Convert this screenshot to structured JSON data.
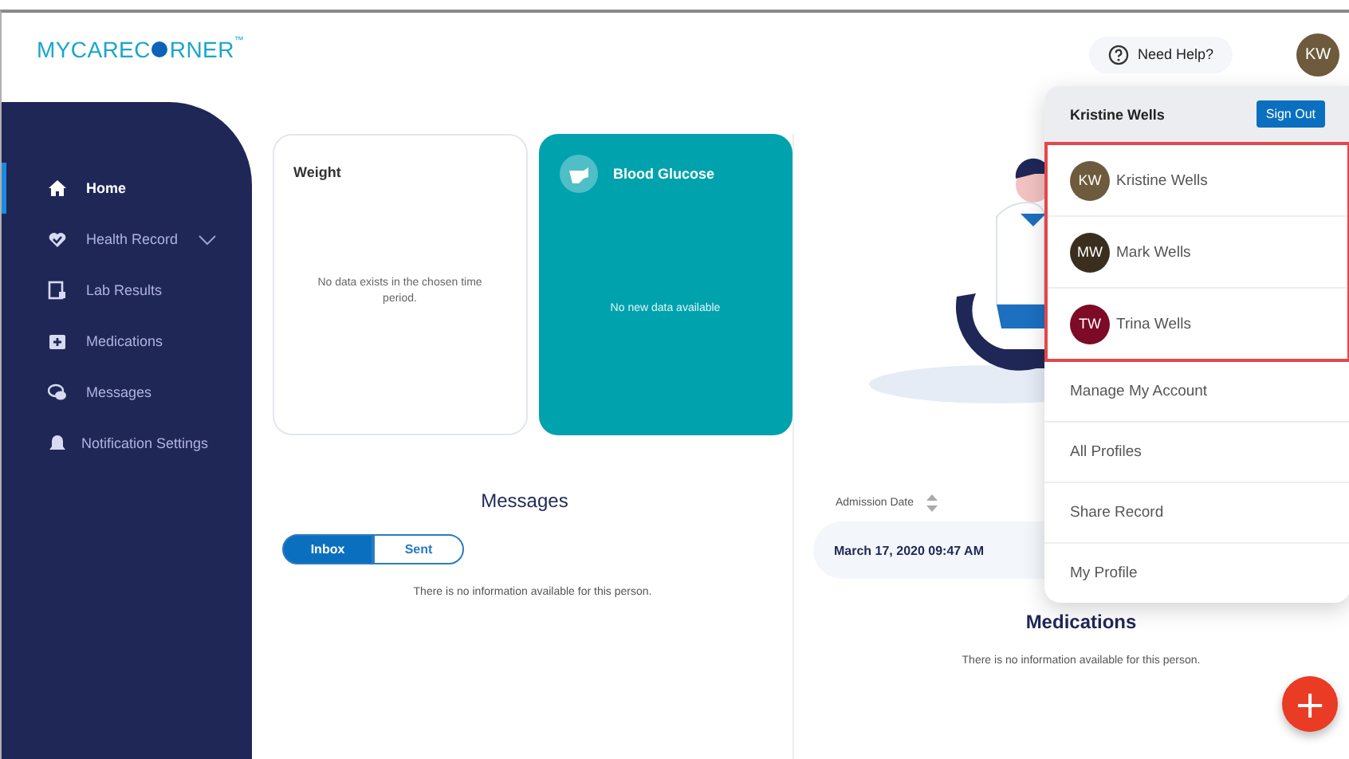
{
  "header": {
    "logo_left": "MYCAREC",
    "logo_right": "RNER",
    "logo_mark": "™",
    "help": "Need Help?",
    "avatar": "KW"
  },
  "sidebar": {
    "items": [
      {
        "label": "Home",
        "selected": true,
        "expandable": false
      },
      {
        "label": "Health Record",
        "selected": false,
        "expandable": true
      },
      {
        "label": "Lab Results",
        "selected": false,
        "expandable": false
      },
      {
        "label": "Medications",
        "selected": false,
        "expandable": false
      },
      {
        "label": "Messages",
        "selected": false,
        "expandable": false
      },
      {
        "label": "Notification Settings",
        "selected": false,
        "expandable": false
      }
    ]
  },
  "cards": [
    {
      "kind": "plain",
      "title": "Weight",
      "message": "No data exists in the chosen time period."
    },
    {
      "kind": "accent",
      "title": "Blood Glucose",
      "message": "No new data available"
    }
  ],
  "messages": {
    "title": "Messages",
    "tabs": [
      {
        "label": "Inbox",
        "selected": true
      },
      {
        "label": "Sent",
        "selected": false
      }
    ],
    "empty": "There is no information available for this person."
  },
  "admissions": {
    "column": "Admission Date",
    "rows": [
      "March 17, 2020 09:47 AM"
    ]
  },
  "medications": {
    "title": "Medications",
    "empty": "There is no information available for this person."
  },
  "account_menu": {
    "name": "Kristine Wells",
    "sign_out": "Sign Out",
    "profiles": [
      {
        "initials": "KW",
        "name": "Kristine Wells",
        "color": "#6e5a3c"
      },
      {
        "initials": "MW",
        "name": "Mark Wells",
        "color": "#3a2f1f"
      },
      {
        "initials": "TW",
        "name": "Trina Wells",
        "color": "#7d0a26"
      }
    ],
    "links": [
      "Manage My Account",
      "All Profiles",
      "Share Record",
      "My Profile"
    ]
  },
  "fab": "+"
}
